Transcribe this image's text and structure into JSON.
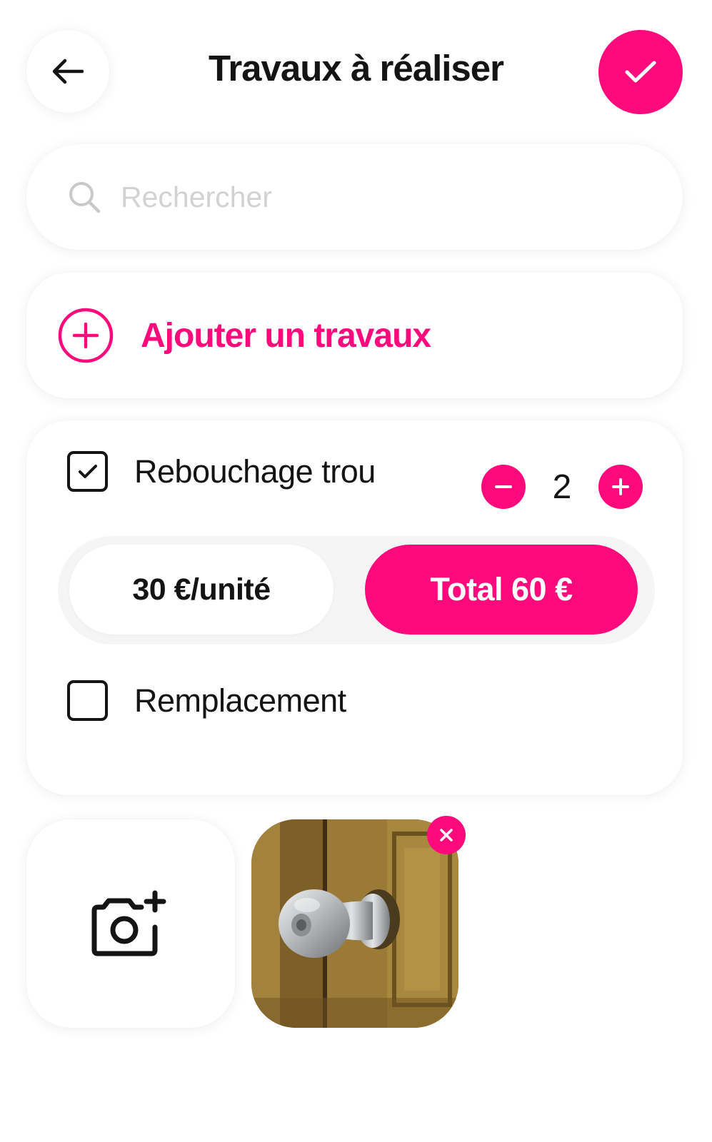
{
  "header": {
    "title": "Travaux à réaliser",
    "back_icon": "arrow-left-icon",
    "confirm_icon": "check-icon"
  },
  "search": {
    "placeholder": "Rechercher",
    "value": "",
    "icon": "search-icon"
  },
  "add_work": {
    "label": "Ajouter un travaux",
    "icon": "plus-circle-icon"
  },
  "items": [
    {
      "label": "Rebouchage trou",
      "checked": true,
      "quantity": "2",
      "unit_price": "30 €/unité",
      "total": "Total 60 €"
    },
    {
      "label": "Remplacement",
      "checked": false
    }
  ],
  "photos": {
    "add_icon": "camera-plus-icon",
    "remove_icon": "close-icon",
    "items": [
      {
        "subject": "door-knob-photo"
      }
    ]
  },
  "colors": {
    "accent": "#ff0a7c",
    "text": "#141414",
    "placeholder": "#d2d2d2",
    "background": "#ffffff"
  }
}
